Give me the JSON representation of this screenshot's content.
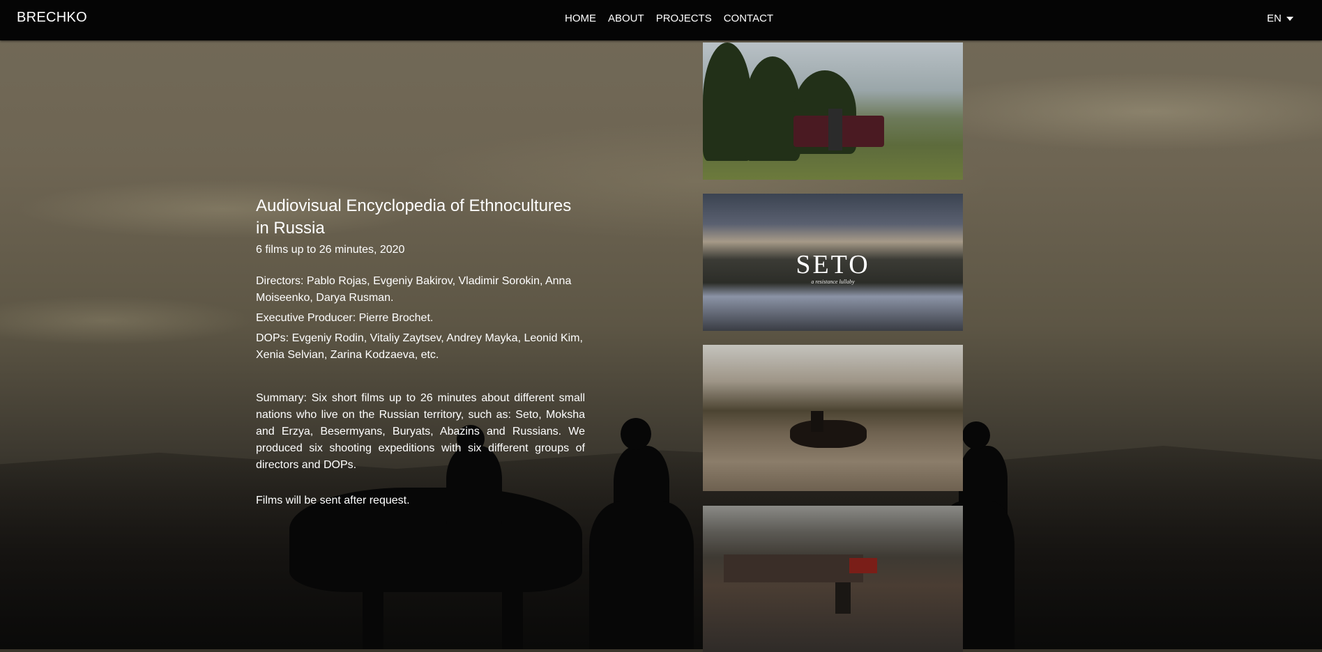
{
  "header": {
    "brand": "BRECHKO",
    "nav": [
      "HOME",
      "ABOUT",
      "PROJECTS",
      "CONTACT"
    ],
    "language": "EN"
  },
  "project": {
    "title": "Audiovisual Encyclopedia of Ethnocultures in Russia",
    "subtitle": "6 films up to 26 minutes, 2020",
    "directors": "Directors: Pablo Rojas, Evgeniy Bakirov, Vladimir Sorokin, Anna Moiseenko, Darya Rusman.",
    "producer": "Executive Producer: Pierre Brochet.",
    "dops": "DOPs: Evgeniy Rodin, Vitaliy Zaytsev, Andrey Mayka, Leonid Kim, Xenia Selvian, Zarina Kodzaeva, etc.",
    "summary": "Summary: Six short films up to 26 minutes about different small nations who live on the Russian territory, such as: Seto, Moksha and Erzya, Besermyans, Buryats, Abazins and Russians. We produced six shooting expeditions with six different groups of directors and DOPs.",
    "note": "Films will be sent after request."
  },
  "thumbnails": {
    "seto_title": "SETO",
    "seto_subtitle": "a resistance lullaby"
  }
}
